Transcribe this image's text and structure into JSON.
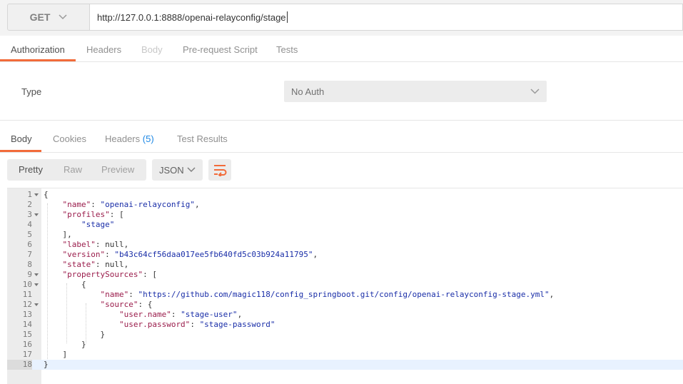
{
  "request": {
    "method": "GET",
    "url": "http://127.0.0.1:8888/openai-relayconfig/stage"
  },
  "request_tabs": [
    {
      "label": "Authorization",
      "state": "active"
    },
    {
      "label": "Headers",
      "state": "normal"
    },
    {
      "label": "Body",
      "state": "disabled"
    },
    {
      "label": "Pre-request Script",
      "state": "normal"
    },
    {
      "label": "Tests",
      "state": "normal"
    }
  ],
  "auth": {
    "type_label": "Type",
    "type_value": "No Auth"
  },
  "response_tabs": {
    "body": "Body",
    "cookies": "Cookies",
    "headers": "Headers",
    "headers_count": "(5)",
    "test_results": "Test Results"
  },
  "body_toolbar": {
    "pretty": "Pretty",
    "raw": "Raw",
    "preview": "Preview",
    "format": "JSON"
  },
  "colors": {
    "accent": "#f26b3a",
    "json_key": "#9a1c4b",
    "json_string": "#1a2ea8",
    "count_blue": "#1e88e5"
  },
  "code_lines": [
    {
      "n": "1",
      "fold": true,
      "parts": [
        [
          "p",
          "{"
        ]
      ]
    },
    {
      "n": "2",
      "fold": false,
      "parts": [
        [
          "p",
          "    "
        ],
        [
          "k",
          "\"name\""
        ],
        [
          "p",
          ": "
        ],
        [
          "s",
          "\"openai-relayconfig\""
        ],
        [
          "p",
          ","
        ]
      ]
    },
    {
      "n": "3",
      "fold": true,
      "parts": [
        [
          "p",
          "    "
        ],
        [
          "k",
          "\"profiles\""
        ],
        [
          "p",
          ": ["
        ]
      ]
    },
    {
      "n": "4",
      "fold": false,
      "parts": [
        [
          "p",
          "        "
        ],
        [
          "s",
          "\"stage\""
        ]
      ]
    },
    {
      "n": "5",
      "fold": false,
      "parts": [
        [
          "p",
          "    ],"
        ]
      ]
    },
    {
      "n": "6",
      "fold": false,
      "parts": [
        [
          "p",
          "    "
        ],
        [
          "k",
          "\"label\""
        ],
        [
          "p",
          ": null,"
        ]
      ]
    },
    {
      "n": "7",
      "fold": false,
      "parts": [
        [
          "p",
          "    "
        ],
        [
          "k",
          "\"version\""
        ],
        [
          "p",
          ": "
        ],
        [
          "s",
          "\"b43c64cf56daa017ee5fb640fd5c03b924a11795\""
        ],
        [
          "p",
          ","
        ]
      ]
    },
    {
      "n": "8",
      "fold": false,
      "parts": [
        [
          "p",
          "    "
        ],
        [
          "k",
          "\"state\""
        ],
        [
          "p",
          ": null,"
        ]
      ]
    },
    {
      "n": "9",
      "fold": true,
      "parts": [
        [
          "p",
          "    "
        ],
        [
          "k",
          "\"propertySources\""
        ],
        [
          "p",
          ": ["
        ]
      ]
    },
    {
      "n": "10",
      "fold": true,
      "parts": [
        [
          "p",
          "        {"
        ]
      ]
    },
    {
      "n": "11",
      "fold": false,
      "parts": [
        [
          "p",
          "            "
        ],
        [
          "k",
          "\"name\""
        ],
        [
          "p",
          ": "
        ],
        [
          "s",
          "\"https://github.com/magic118/config_springboot.git/config/openai-relayconfig-stage.yml\""
        ],
        [
          "p",
          ","
        ]
      ]
    },
    {
      "n": "12",
      "fold": true,
      "parts": [
        [
          "p",
          "            "
        ],
        [
          "k",
          "\"source\""
        ],
        [
          "p",
          ": {"
        ]
      ]
    },
    {
      "n": "13",
      "fold": false,
      "parts": [
        [
          "p",
          "                "
        ],
        [
          "k",
          "\"user.name\""
        ],
        [
          "p",
          ": "
        ],
        [
          "s",
          "\"stage-user\""
        ],
        [
          "p",
          ","
        ]
      ]
    },
    {
      "n": "14",
      "fold": false,
      "parts": [
        [
          "p",
          "                "
        ],
        [
          "k",
          "\"user.password\""
        ],
        [
          "p",
          ": "
        ],
        [
          "s",
          "\"stage-password\""
        ]
      ]
    },
    {
      "n": "15",
      "fold": false,
      "parts": [
        [
          "p",
          "            }"
        ]
      ]
    },
    {
      "n": "16",
      "fold": false,
      "parts": [
        [
          "p",
          "        }"
        ]
      ]
    },
    {
      "n": "17",
      "fold": false,
      "parts": [
        [
          "p",
          "    ]"
        ]
      ]
    },
    {
      "n": "18",
      "fold": false,
      "active": true,
      "parts": [
        [
          "p",
          "}"
        ]
      ]
    }
  ]
}
